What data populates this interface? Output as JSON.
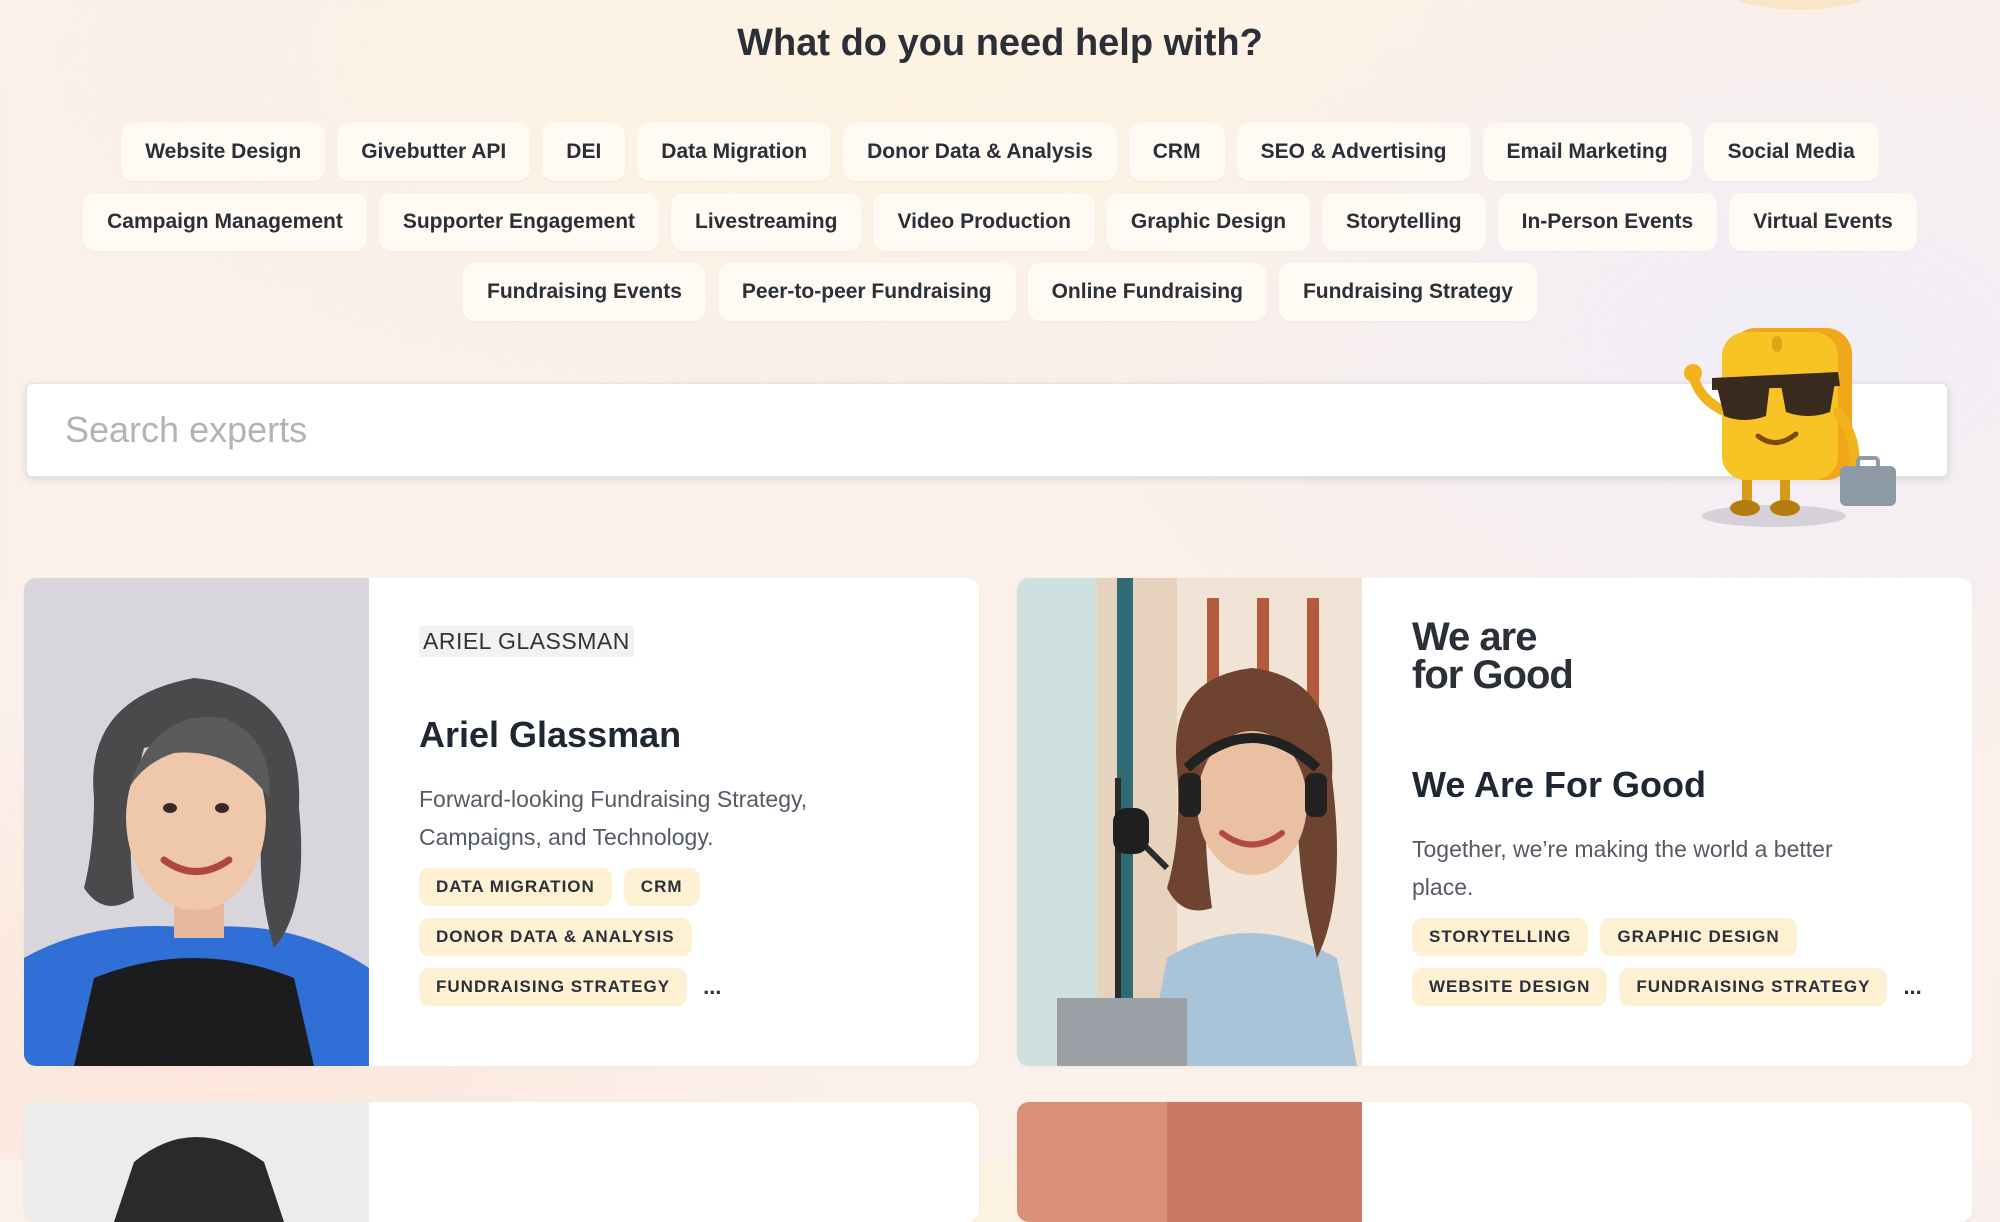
{
  "heading": "What do you need help with?",
  "chip_rows": [
    [
      "Website Design",
      "Givebutter API",
      "DEI",
      "Data Migration",
      "Donor Data & Analysis",
      "CRM",
      "SEO & Advertising",
      "Email Marketing",
      "Social Media"
    ],
    [
      "Campaign Management",
      "Supporter Engagement",
      "Livestreaming",
      "Video Production",
      "Graphic Design",
      "Storytelling",
      "In-Person Events",
      "Virtual Events"
    ],
    [
      "Fundraising Events",
      "Peer-to-peer Fundraising",
      "Online Fundraising",
      "Fundraising Strategy"
    ]
  ],
  "search": {
    "placeholder": "Search experts"
  },
  "cards": [
    {
      "brand": "ARIEL GLASSMAN",
      "name": "Ariel Glassman",
      "description": "Forward-looking Fundraising Strategy, Campaigns, and Technology.",
      "tag_rows": [
        [
          "DATA MIGRATION",
          "CRM"
        ],
        [
          "DONOR DATA & ANALYSIS"
        ],
        [
          "FUNDRAISING STRATEGY"
        ]
      ],
      "more": "..."
    },
    {
      "brand_line1": "We are",
      "brand_line2": "for Good",
      "name": "We Are For Good",
      "description": "Together, we’re making the world a better place.",
      "tag_rows": [
        [
          "STORYTELLING",
          "GRAPHIC DESIGN"
        ],
        [
          "WEBSITE DESIGN",
          "FUNDRAISING STRATEGY"
        ]
      ],
      "more": "..."
    }
  ],
  "colors": {
    "chip_bg": "#fffaf3",
    "tag_bg": "#fdf0d3",
    "text": "#2b2f38",
    "mascot_yellow": "#f7c325"
  }
}
